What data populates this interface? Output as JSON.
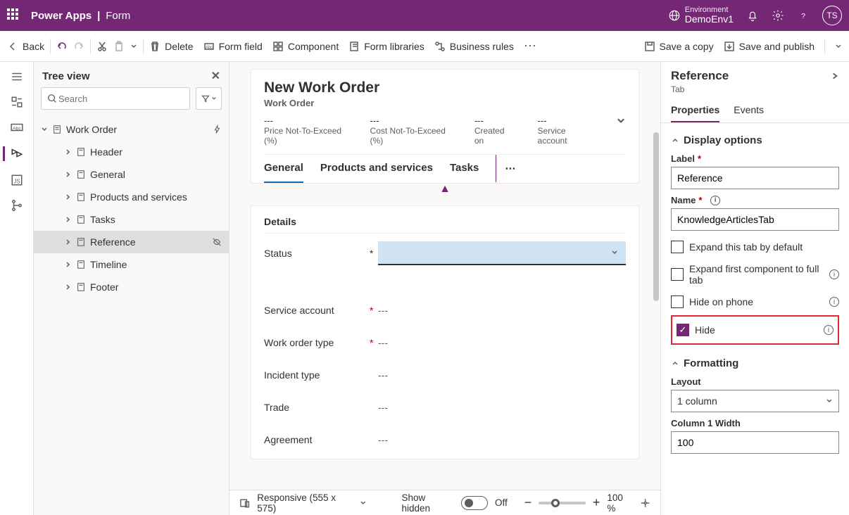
{
  "top": {
    "brand": "Power Apps",
    "brandSub": "Form",
    "envLabel": "Environment",
    "envValue": "DemoEnv1",
    "avatar": "TS"
  },
  "cmd": {
    "back": "Back",
    "delete": "Delete",
    "formField": "Form field",
    "component": "Component",
    "formLibraries": "Form libraries",
    "businessRules": "Business rules",
    "saveCopy": "Save a copy",
    "savePublish": "Save and publish"
  },
  "tree": {
    "title": "Tree view",
    "searchPh": "Search",
    "root": "Work Order",
    "items": [
      "Header",
      "General",
      "Products and services",
      "Tasks",
      "Reference",
      "Timeline",
      "Footer"
    ],
    "selectedIndex": 4
  },
  "form": {
    "title": "New Work Order",
    "subtitle": "Work Order",
    "headerFields": [
      {
        "v": "---",
        "l": "Price Not-To-Exceed (%)"
      },
      {
        "v": "---",
        "l": "Cost Not-To-Exceed (%)"
      },
      {
        "v": "---",
        "l": "Created on"
      },
      {
        "v": "---",
        "l": "Service account"
      }
    ],
    "tabs": [
      "General",
      "Products and services",
      "Tasks"
    ],
    "activeTab": 0,
    "section": "Details",
    "fields": [
      {
        "label": "Status",
        "required": true,
        "value": "",
        "dropdown": true
      },
      {
        "label": "Service account",
        "required": true,
        "value": "---"
      },
      {
        "label": "Work order type",
        "required": true,
        "value": "---"
      },
      {
        "label": "Incident type",
        "required": false,
        "value": "---"
      },
      {
        "label": "Trade",
        "required": false,
        "value": "---"
      },
      {
        "label": "Agreement",
        "required": false,
        "value": "---"
      }
    ]
  },
  "bottom": {
    "responsive": "Responsive (555 x 575)",
    "showHidden": "Show hidden",
    "off": "Off",
    "zoom": "100 %"
  },
  "props": {
    "title": "Reference",
    "sub": "Tab",
    "tabs": [
      "Properties",
      "Events"
    ],
    "activeTab": 0,
    "display": "Display options",
    "labelLbl": "Label",
    "labelVal": "Reference",
    "nameLbl": "Name",
    "nameVal": "KnowledgeArticlesTab",
    "checks": [
      {
        "label": "Expand this tab by default",
        "checked": false,
        "info": false
      },
      {
        "label": "Expand first component to full tab",
        "checked": false,
        "info": true
      },
      {
        "label": "Hide on phone",
        "checked": false,
        "info": true
      },
      {
        "label": "Hide",
        "checked": true,
        "info": true,
        "highlight": true
      }
    ],
    "formatting": "Formatting",
    "layoutLbl": "Layout",
    "layoutVal": "1 column",
    "colWLbl": "Column 1 Width",
    "colWVal": "100"
  }
}
